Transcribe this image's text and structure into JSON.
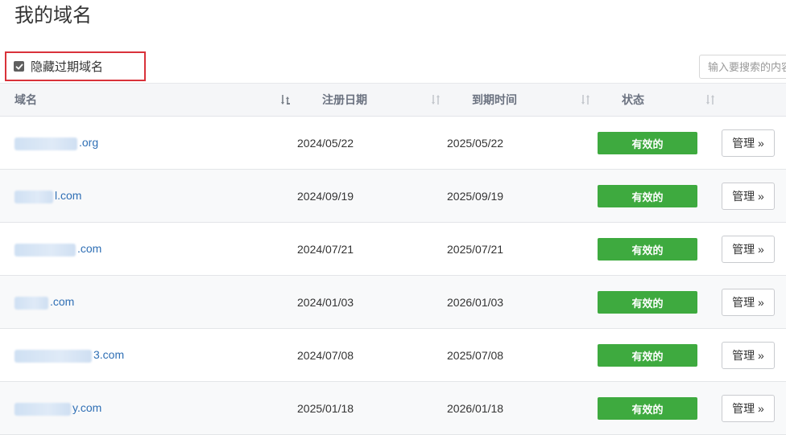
{
  "page": {
    "title": "我的域名"
  },
  "filter": {
    "hide_expired_label": "隐藏过期域名",
    "hide_expired_checked": true
  },
  "search": {
    "placeholder": "输入要搜索的内容"
  },
  "table": {
    "headers": {
      "domain": "域名",
      "reg_date": "注册日期",
      "expire_date": "到期时间",
      "status": "状态"
    },
    "rows": [
      {
        "domain_visible": ".org",
        "reg_date": "2024/05/22",
        "expire_date": "2025/05/22",
        "status": "有效的",
        "action": "管理 »"
      },
      {
        "domain_visible": "l.com",
        "reg_date": "2024/09/19",
        "expire_date": "2025/09/19",
        "status": "有效的",
        "action": "管理 »"
      },
      {
        "domain_visible": ".com",
        "reg_date": "2024/07/21",
        "expire_date": "2025/07/21",
        "status": "有效的",
        "action": "管理 »"
      },
      {
        "domain_visible": ".com",
        "reg_date": "2024/01/03",
        "expire_date": "2026/01/03",
        "status": "有效的",
        "action": "管理 »"
      },
      {
        "domain_visible": "3.com",
        "reg_date": "2024/07/08",
        "expire_date": "2025/07/08",
        "status": "有效的",
        "action": "管理 »"
      },
      {
        "domain_visible": "y.com",
        "reg_date": "2025/01/18",
        "expire_date": "2026/01/18",
        "status": "有效的",
        "action": "管理 »"
      }
    ]
  },
  "colors": {
    "status_active": "#3eaa3f",
    "link": "#2f6fb5",
    "highlight_border": "#d9323a"
  },
  "icons": {
    "sort": "sort-icon",
    "check": "check-icon"
  }
}
